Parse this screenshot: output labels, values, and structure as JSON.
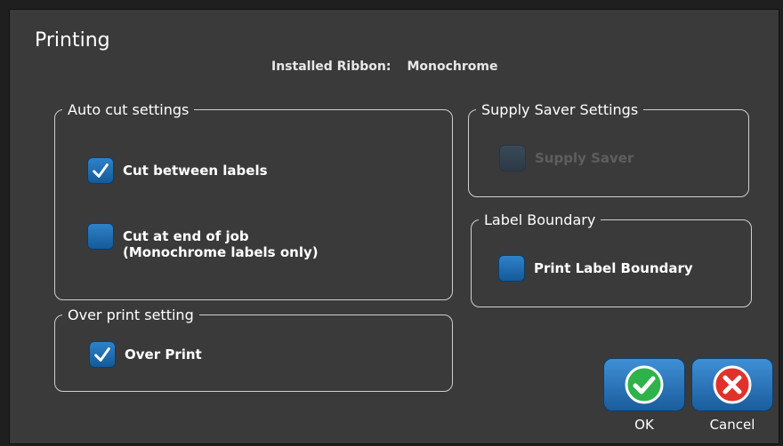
{
  "window": {
    "title": "Printing"
  },
  "ribbon": {
    "label": "Installed Ribbon:",
    "value": "Monochrome"
  },
  "auto_cut": {
    "legend": "Auto cut settings",
    "cut_between": {
      "label": "Cut between labels",
      "checked": true
    },
    "cut_end": {
      "label": "Cut at end of job\n(Monochrome labels only)",
      "checked": false
    }
  },
  "over_print": {
    "legend": "Over print setting",
    "over_print": {
      "label": "Over Print",
      "checked": true
    }
  },
  "supply_saver": {
    "legend": "Supply Saver Settings",
    "supply_saver": {
      "label": "Supply Saver",
      "checked": false,
      "enabled": false
    }
  },
  "label_boundary": {
    "legend": "Label Boundary",
    "print_boundary": {
      "label": "Print Label Boundary",
      "checked": false
    }
  },
  "buttons": {
    "ok": "OK",
    "cancel": "Cancel"
  },
  "icons": {
    "check": "check-icon",
    "ok": "ok-check-icon",
    "cancel": "cancel-x-icon"
  },
  "colors": {
    "accent": "#1f6fb5",
    "ok_green": "#2fb24a",
    "cancel_red": "#e0322b"
  }
}
